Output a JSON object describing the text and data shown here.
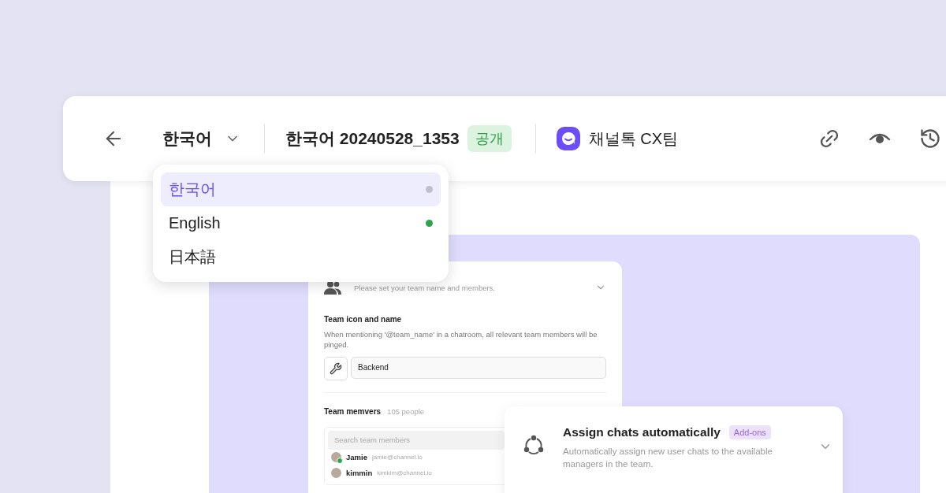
{
  "toolbar": {
    "language": "한국어",
    "title": "한국어 20240528_1353",
    "visibility_badge": "공개",
    "workspace": "채널톡 CX팀"
  },
  "language_menu": [
    {
      "label": "한국어",
      "selected": true,
      "color": "#c0bfc8"
    },
    {
      "label": "English",
      "selected": false,
      "color": "#2ea44f"
    },
    {
      "label": "日本語",
      "selected": false
    }
  ],
  "preview": {
    "team_setting": {
      "subtitle": "Please set your team name and members.",
      "section_title": "Team icon and name",
      "section_description": "When mentioning '@team_name' in a chatroom, all relevant team members will be pinged.",
      "name_value": "Backend",
      "members_title": "Team memvers",
      "members_count": "105 people",
      "search_placeholder": "Search team members",
      "members": [
        {
          "name": "Jamie",
          "email": "jamie@channel.io",
          "online": true
        },
        {
          "name": "kimmin",
          "email": "kimkim@channel.io",
          "online": false
        }
      ]
    },
    "assign_card": {
      "title": "Assign chats automatically",
      "badge": "Add-ons",
      "description": "Automatically assign new user chats to the available managers in the team."
    }
  }
}
